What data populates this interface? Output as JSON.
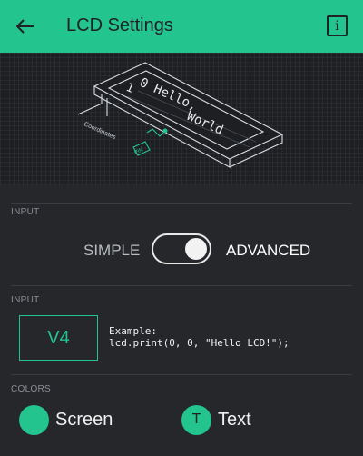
{
  "header": {
    "title": "LCD Settings",
    "back_icon": "arrow-left-icon",
    "info_icon": "info-icon",
    "info_glyph": "i"
  },
  "illustration": {
    "lcd_text_row1": "0 Hello,",
    "lcd_text_row2": "World",
    "row_index": "1",
    "coordinates_label": "Coordinates",
    "pin_label": "PIN"
  },
  "input_mode": {
    "section_label": "INPUT",
    "simple_label": "SIMPLE",
    "advanced_label": "ADVANCED",
    "toggle_state": "advanced"
  },
  "input": {
    "section_label": "INPUT",
    "pin_value": "V4",
    "example_line1": "Example:",
    "example_line2": "lcd.print(0, 0, \"Hello LCD!\");"
  },
  "colors": {
    "section_label": "COLORS",
    "screen_label": "Screen",
    "text_label": "Text",
    "text_swatch_glyph": "T",
    "accent": "#23c48e"
  }
}
